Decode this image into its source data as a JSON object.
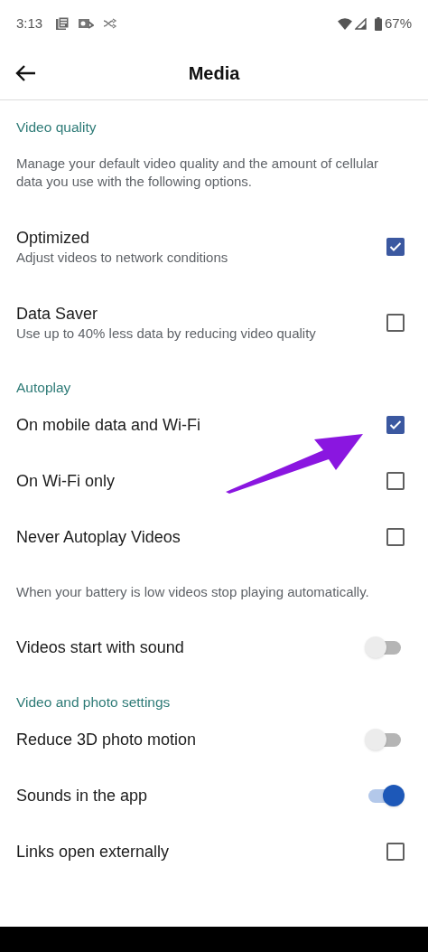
{
  "status_bar": {
    "time": "3:13",
    "battery": "67%"
  },
  "app_bar": {
    "title": "Media"
  },
  "items": [
    {
      "kind": "header",
      "label": "Video quality"
    },
    {
      "kind": "note",
      "text": "Manage your default video quality and the amount of cellular data you use with the following options."
    },
    {
      "kind": "checkbox",
      "label": "Optimized",
      "description": "Adjust videos to network conditions",
      "checked": true
    },
    {
      "kind": "checkbox",
      "label": "Data Saver",
      "description": "Use up to 40% less data by reducing video quality",
      "checked": false
    },
    {
      "kind": "header",
      "label": "Autoplay"
    },
    {
      "kind": "checkbox",
      "label": "On mobile data and Wi-Fi",
      "checked": true
    },
    {
      "kind": "checkbox",
      "label": "On Wi-Fi only",
      "checked": false
    },
    {
      "kind": "checkbox",
      "label": "Never Autoplay Videos",
      "checked": false
    },
    {
      "kind": "note",
      "text": "When your battery is low videos stop playing automatically."
    },
    {
      "kind": "toggle",
      "label": "Videos start with sound",
      "on": false
    },
    {
      "kind": "header",
      "label": "Video and photo settings"
    },
    {
      "kind": "toggle",
      "label": "Reduce 3D photo motion",
      "on": false
    },
    {
      "kind": "toggle",
      "label": "Sounds in the app",
      "on": true
    },
    {
      "kind": "checkbox",
      "label": "Links open externally",
      "checked": false
    }
  ]
}
